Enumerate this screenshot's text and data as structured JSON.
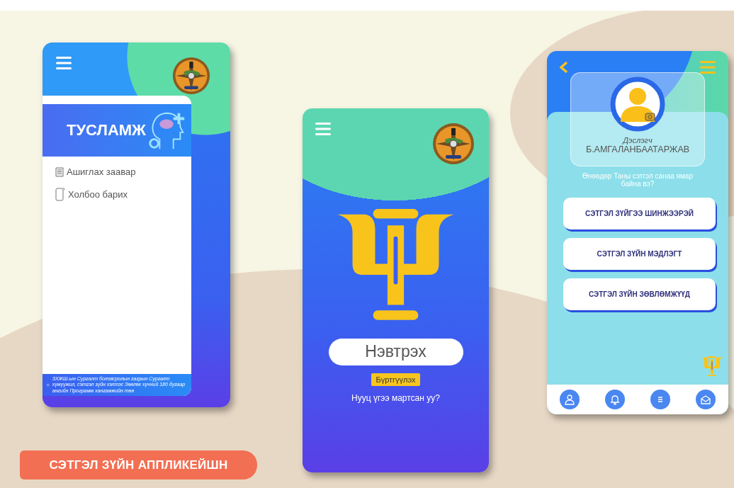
{
  "help_screen": {
    "title": "ТУСЛАМЖ",
    "items": [
      {
        "kind": "document",
        "label": "Ашиглах заавар"
      },
      {
        "kind": "phone",
        "label": "Холбоо барих"
      }
    ],
    "footer": "ЗХЖШ-ын Сургалт боловсролын газрын Сургалт хүмүүжил, сэтгэл зүйн хэлтэс Зөвлөх хүчний 180 дугаар ангийн Программ хангамжийн төв"
  },
  "login_screen": {
    "login_button": "Нэвтрэх",
    "register_button": "Бүртгүүлэх",
    "forgot_link": "Нууц үгээ мартсан уу?"
  },
  "profile_screen": {
    "role": "Дэслэгч",
    "name": "Б.АМГАЛАНБААТАРЖАВ",
    "question": "Өнөөдөр Таны сэтгэл санаа ямар байна вэ?",
    "menu": [
      "СЭТГЭЛ ЗҮЙГЭЭ ШИНЖЭЭРЭЙ",
      "СЭТГЭЛ ЗҮЙН МЭДЛЭГТ",
      "СЭТГЭЛ ЗҮЙН ЗӨВЛӨМЖҮҮД"
    ],
    "nav": [
      {
        "kind": "user"
      },
      {
        "kind": "bell"
      },
      {
        "kind": "menu"
      },
      {
        "kind": "mail"
      }
    ]
  },
  "caption": "СЭТГЭЛ ЗҮЙН АППЛИКЕЙШН"
}
